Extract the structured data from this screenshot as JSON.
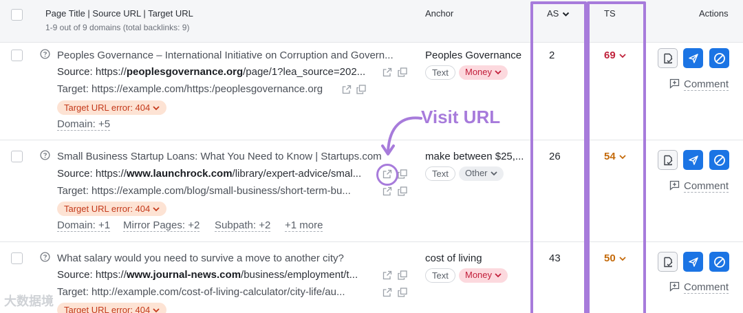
{
  "header": {
    "title_col": "Page Title | Source URL | Target URL",
    "summary": "1-9 out of 9 domains (total backlinks: 9)",
    "anchor_col": "Anchor",
    "as_col": "AS",
    "ts_col": "TS",
    "actions_col": "Actions"
  },
  "rows": [
    {
      "title": "Peoples Governance – International Initiative on Corruption and Govern...",
      "source_prefix": "Source: https://",
      "source_domain": "peoplesgovernance.org",
      "source_rest": "/page/1?lea_source=202...",
      "target": "Target: https://example.com/https:/peoplesgovernance.org",
      "error": "Target URL error: 404",
      "meta": [
        "Domain: +5"
      ],
      "anchor": "Peoples Governance",
      "tags": [
        "Text",
        "Money"
      ],
      "as": "2",
      "ts": "69",
      "comment": "Comment"
    },
    {
      "title": "Small Business Startup Loans: What You Need to Know | Startups.com",
      "source_prefix": "Source: https://",
      "source_domain": "www.launchrock.com",
      "source_rest": "/library/expert-advice/smal...",
      "target": "Target: https://example.com/blog/small-business/short-term-bu...",
      "error": "Target URL error: 404",
      "meta": [
        "Domain: +1",
        "Mirror Pages: +2",
        "Subpath: +2",
        "+1 more"
      ],
      "anchor": "make between $25,...",
      "tags": [
        "Text",
        "Other"
      ],
      "as": "26",
      "ts": "54",
      "comment": "Comment"
    },
    {
      "title": "What salary would you need to survive a move to another city?",
      "source_prefix": "Source: https://",
      "source_domain": "www.journal-news.com",
      "source_rest": "/business/employment/t...",
      "target": "Target: http://example.com/cost-of-living-calculator/city-life/au...",
      "error": "Target URL error: 404",
      "meta": [],
      "anchor": "cost of living",
      "tags": [
        "Text",
        "Money"
      ],
      "as": "43",
      "ts": "50",
      "comment": "Comment"
    }
  ],
  "annotation": {
    "label": "Visit URL"
  },
  "watermark": "大数据境",
  "colors": {
    "accent_purple": "#a77bdb",
    "action_blue": "#1b74e4",
    "ts_red": "#c0223b",
    "ts_orange": "#c46a0a",
    "error_bg": "#fde3d4",
    "money_bg": "#fcd9de"
  },
  "icons": [
    "question-circle-icon",
    "external-link-icon",
    "copy-icon",
    "chevron-down-icon",
    "edit-doc-icon",
    "send-icon",
    "block-icon",
    "comment-plus-icon"
  ]
}
